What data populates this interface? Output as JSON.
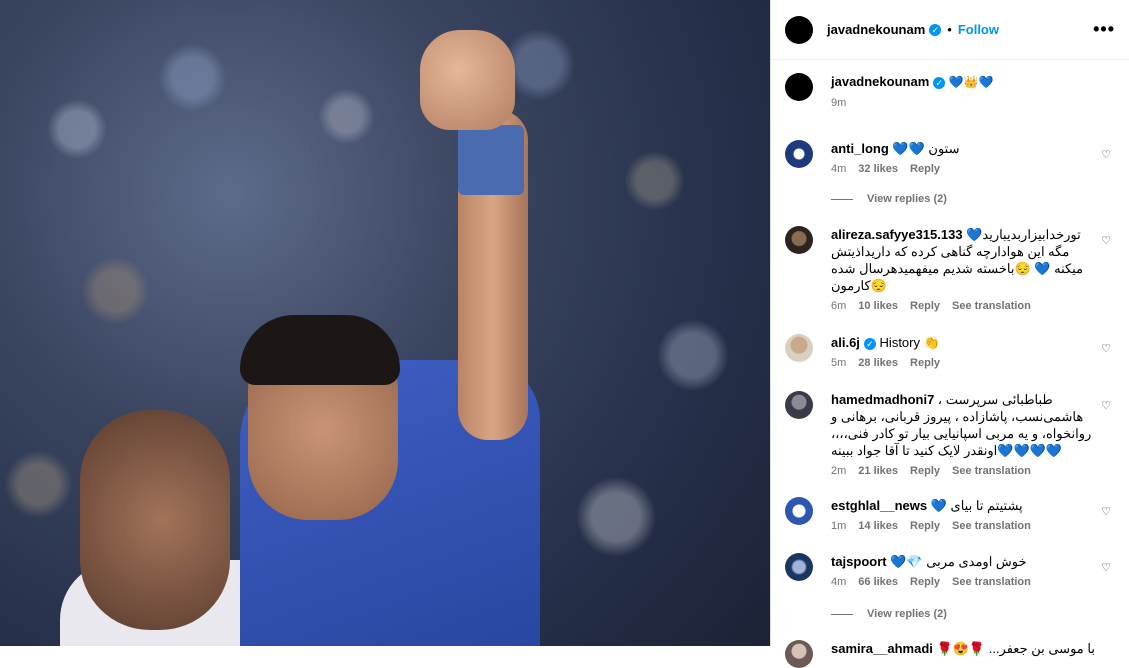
{
  "post": {
    "author": "javadnekounam",
    "follow_label": "Follow",
    "dot": "•",
    "more": "•••",
    "caption_text": "💙👑💙",
    "caption_time": "9m"
  },
  "comments": [
    {
      "user": "anti_long",
      "text": "💙💙 ستون",
      "time": "4m",
      "likes": "32 likes",
      "reply": "Reply",
      "translate": ""
    },
    {
      "user": "alireza.safyye315.133",
      "text": "تورخدابیزاربدیبارید💙 مگه این هوادارچه گناهی کرده که داریداذیتش میکنه 💙 😔باخسته شدیم میفهمیدهرسال شده کارمون😔",
      "time": "6m",
      "likes": "10 likes",
      "reply": "Reply",
      "translate": "See translation"
    },
    {
      "user": "ali.6j",
      "text": "History 👏",
      "time": "5m",
      "likes": "28 likes",
      "reply": "Reply",
      "translate": ""
    },
    {
      "user": "hamedmadhoni7",
      "text": "طباطبائی سرپرست ، هاشمی‌نسب، پاشازاده ، پیروز قربانی، برهانی و روانخواه، و یه مربی اسپانیایی بیار تو کادر فنی،،،، اونقدر لایک کنید تا آقا جواد ببینه💙💙💙💙",
      "time": "2m",
      "likes": "21 likes",
      "reply": "Reply",
      "translate": "See translation"
    },
    {
      "user": "estghlal__news",
      "text": "💙 پشتیتم تا بیای",
      "time": "1m",
      "likes": "14 likes",
      "reply": "Reply",
      "translate": "See translation"
    },
    {
      "user": "tajspoort",
      "text": "💙💎 خوش اومدی مربی",
      "time": "4m",
      "likes": "66 likes",
      "reply": "Reply",
      "translate": "See translation"
    },
    {
      "user": "samira__ahmadi",
      "text": "🌹😍🌹 ...با موسی بن جعفر",
      "time": "",
      "likes": "",
      "reply": "",
      "translate": ""
    }
  ],
  "view_replies_1": "View replies (2)",
  "view_replies_2": "View replies (2)",
  "icons": {
    "verified": "verified-badge-icon",
    "heart": "heart-outline-icon",
    "more": "more-options-icon"
  },
  "colors": {
    "accent": "#0095f6",
    "muted": "#737373",
    "jersey": "#2746a0"
  }
}
